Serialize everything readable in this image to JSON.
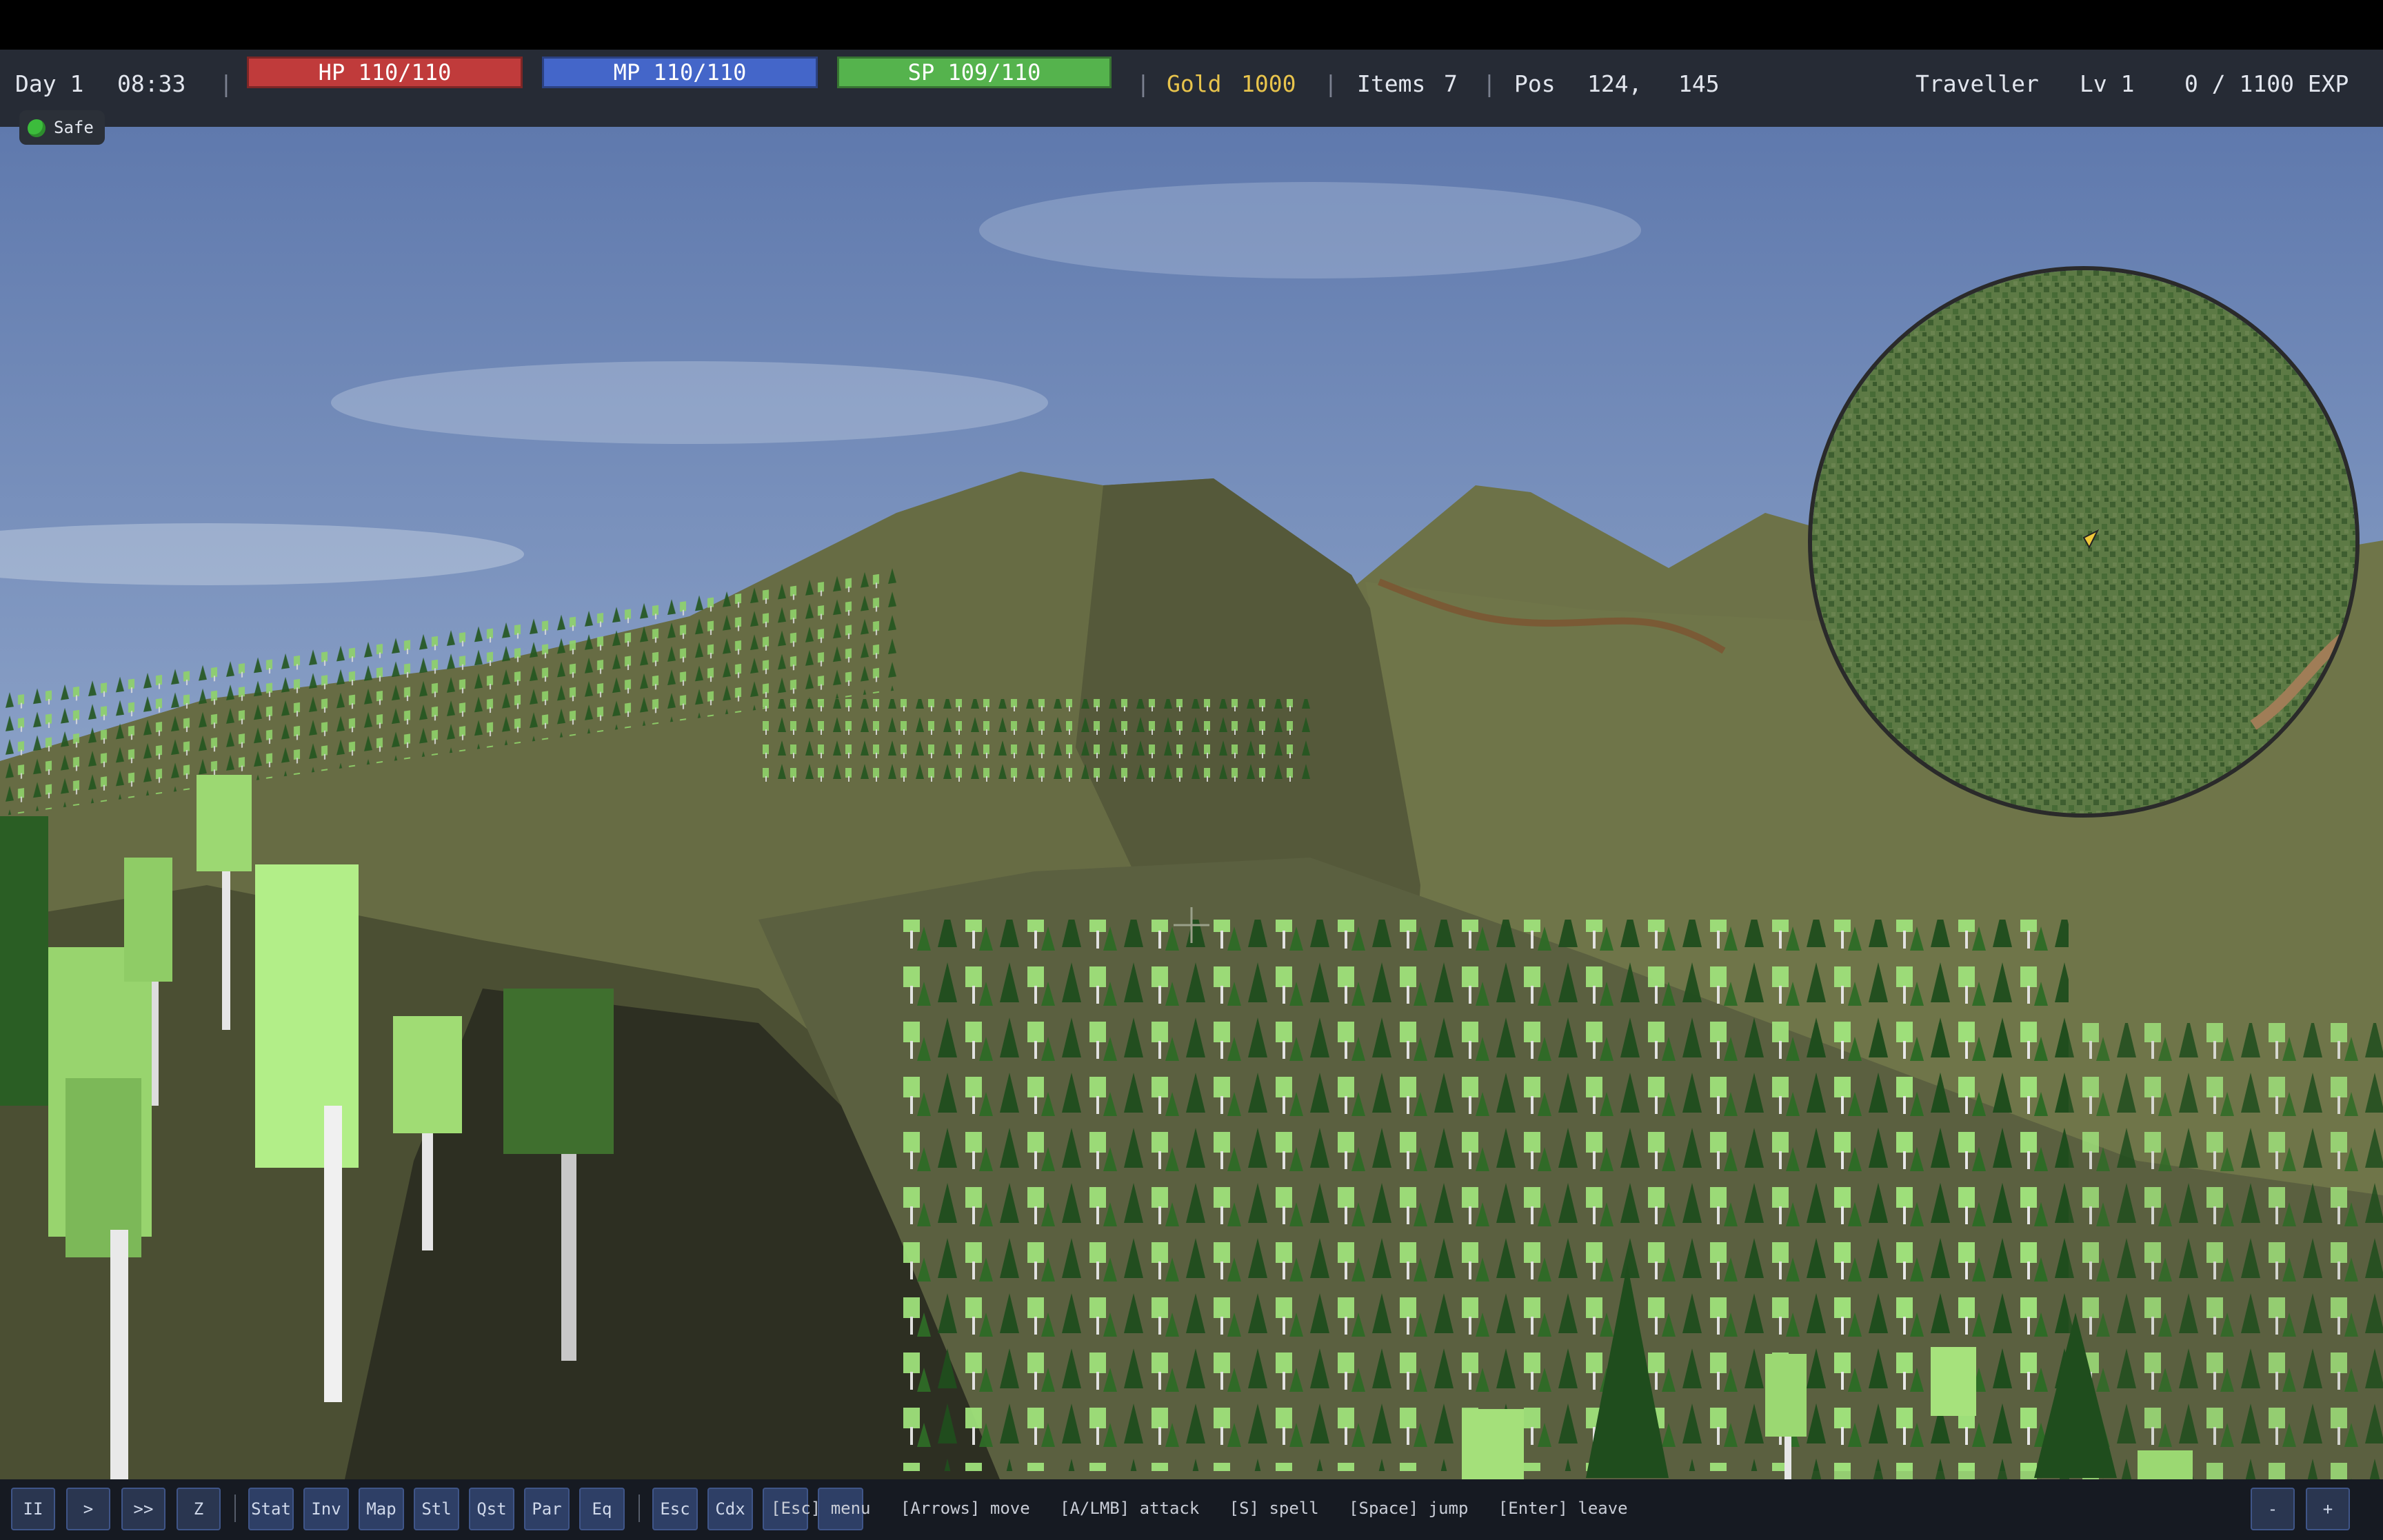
{
  "hud": {
    "day": "Day 1",
    "time": "08:33",
    "hp": "HP 110/110",
    "mp": "MP 110/110",
    "sp": "SP 109/110",
    "gold_label": "Gold",
    "gold_value": "1000",
    "items_label": "Items",
    "items_value": "7",
    "pos_label": "Pos",
    "pos_x": "124,",
    "pos_y": "145",
    "class_name": "Traveller",
    "level": "Lv 1",
    "exp": "0 / 1100 EXP",
    "colors": {
      "hp": "#c03b3b",
      "mp": "#4466c9",
      "sp": "#55b34d",
      "gold": "#e8c44c"
    }
  },
  "status": {
    "safe_label": "Safe",
    "icon": "green-dot-icon"
  },
  "bottom": {
    "controls": [
      "II",
      ">",
      ">>",
      "Z"
    ],
    "panels": [
      "Stat",
      "Inv",
      "Map",
      "Stl",
      "Qst",
      "Par",
      "Eq"
    ],
    "system": [
      "Esc",
      "Cdx"
    ],
    "hints": "[Esc] menu   [Arrows] move   [A/LMB] attack   [S] spell   [Space] jump   [Enter] leave",
    "zoom_out": "-",
    "zoom_in": "+"
  }
}
